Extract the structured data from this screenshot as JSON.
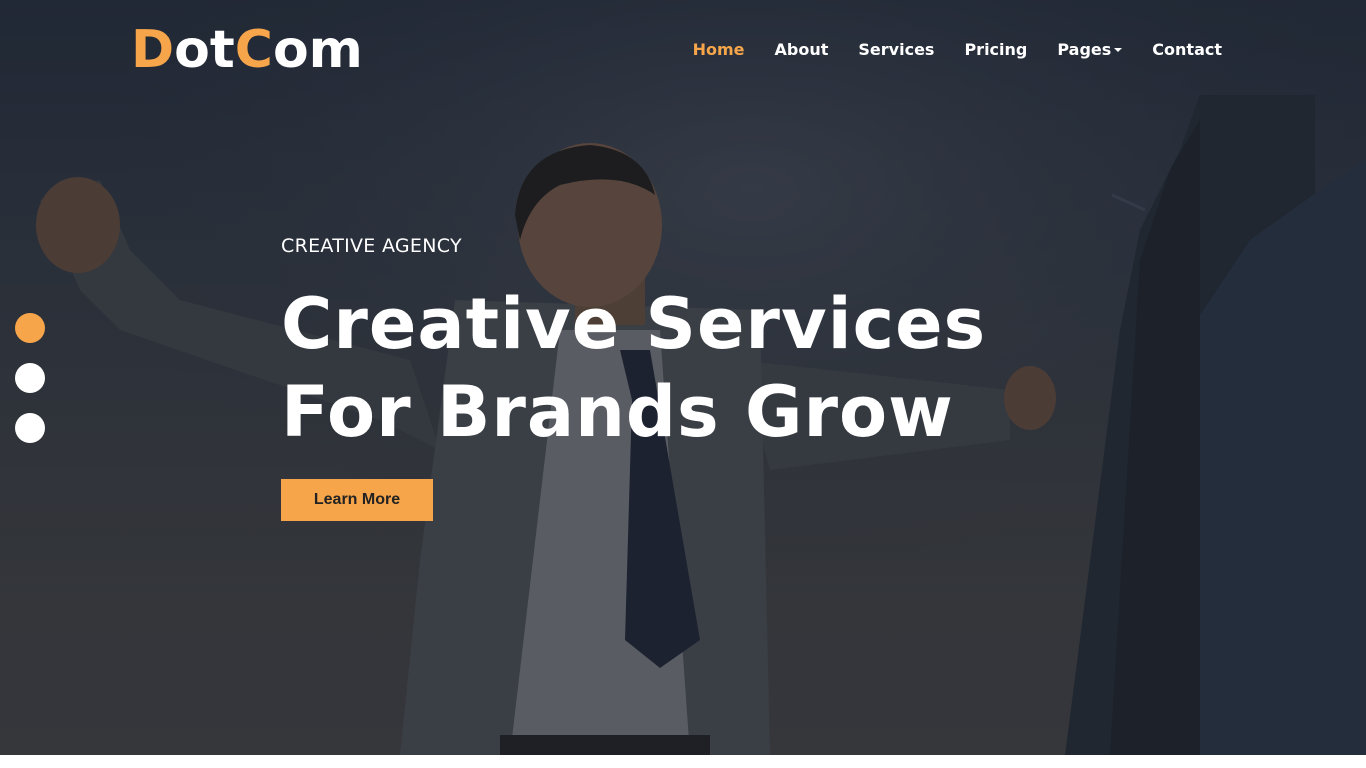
{
  "logo": {
    "part1": "D",
    "part2": "ot",
    "part3": "C",
    "part4": "om"
  },
  "nav": {
    "home": "Home",
    "about": "About",
    "services": "Services",
    "pricing": "Pricing",
    "pages": "Pages",
    "contact": "Contact"
  },
  "hero": {
    "kicker": "CREATIVE AGENCY",
    "headline_line1": "Creative Services",
    "headline_line2": "For Brands Grow",
    "button_label": "Learn More"
  },
  "slider": {
    "active_index": 0,
    "dot_count": 3
  },
  "colors": {
    "accent": "#f7a54a",
    "overlay": "#2a2f3a",
    "text": "#ffffff"
  }
}
